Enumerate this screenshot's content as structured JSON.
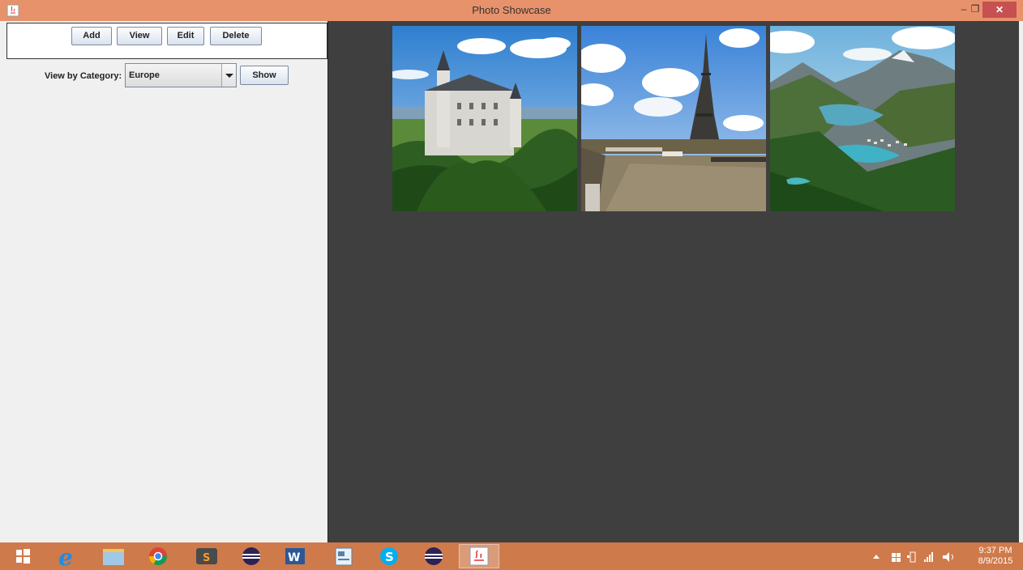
{
  "window": {
    "title": "Photo Showcase",
    "minimize_label": "–",
    "maximize_label": "❐",
    "close_label": "✕"
  },
  "toolbar": {
    "add_label": "Add",
    "view_label": "View",
    "edit_label": "Edit",
    "delete_label": "Delete"
  },
  "category": {
    "label": "View by Category:",
    "selected": "Europe",
    "show_label": "Show"
  },
  "gallery": {
    "photos": [
      {
        "subject": "castle-photo"
      },
      {
        "subject": "eiffel-tower-photo"
      },
      {
        "subject": "mountain-valley-photo"
      }
    ]
  },
  "taskbar": {
    "apps": [
      "windows-start-icon",
      "internet-explorer-icon",
      "file-explorer-icon",
      "chrome-icon",
      "sublime-text-icon",
      "eclipse-icon",
      "word-icon",
      "document-app-icon",
      "skype-icon",
      "eclipse-icon",
      "java-icon"
    ],
    "time": "9:37 PM",
    "date": "8/9/2015"
  },
  "colors": {
    "titlebar": "#e8926c",
    "close_button": "#c75050",
    "gallery_bg": "#3f3f3f",
    "taskbar": "#cf7a4b"
  }
}
